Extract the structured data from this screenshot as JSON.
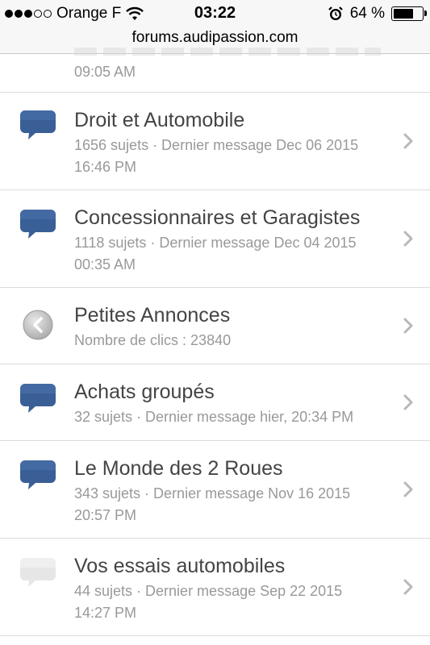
{
  "status": {
    "carrier": "Orange F",
    "time": "03:22",
    "battery": "64 %",
    "battery_level": 0.64
  },
  "url_bar": {
    "domain": "forums.audipassion.com"
  },
  "partial_row": {
    "time": "09:05 AM"
  },
  "forums": [
    {
      "title": "Droit et Automobile",
      "line1": "1656 sujets · Dernier message Dec 06 2015",
      "line2": "16:46 PM",
      "icon": "speech-bubble-blue-icon"
    },
    {
      "title": "Concessionnaires et Garagistes",
      "line1": "1118 sujets · Dernier message Dec 04 2015",
      "line2": "00:35 AM",
      "icon": "speech-bubble-blue-icon"
    },
    {
      "title": "Petites Annonces",
      "line1": "Nombre de clics : 23840",
      "icon": "redirect-link-icon"
    },
    {
      "title": "Achats groupés",
      "line1": "32 sujets · Dernier message hier, 20:34 PM",
      "icon": "speech-bubble-blue-icon"
    },
    {
      "title": "Le Monde des 2 Roues",
      "line1": "343 sujets · Dernier message Nov 16 2015",
      "line2": "20:57 PM",
      "icon": "speech-bubble-blue-icon"
    },
    {
      "title": "Vos essais automobiles",
      "line1": "44 sujets · Dernier message Sep 22 2015",
      "line2": "14:27 PM",
      "icon": "speech-bubble-grey-icon"
    }
  ],
  "colors": {
    "bubble_blue": "#3a5f96",
    "bubble_grey": "#e4e4e4",
    "title_text": "#444444",
    "meta_text": "#999999"
  }
}
